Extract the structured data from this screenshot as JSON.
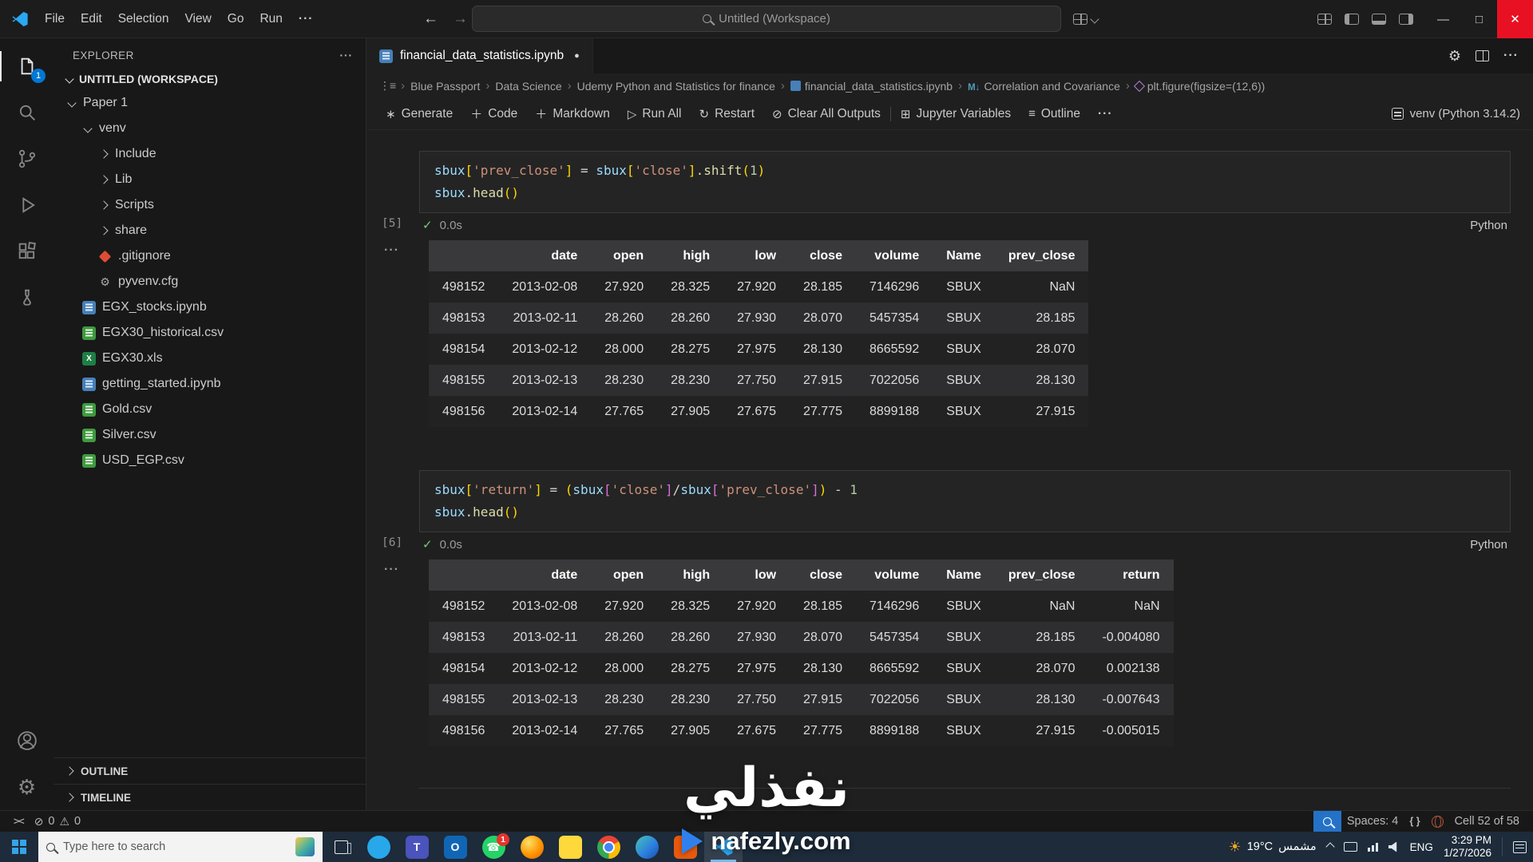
{
  "colors": {
    "accent": "#0078d4",
    "close_button": "#e81123",
    "string": "#CE9178",
    "variable": "#9CDCFE",
    "function": "#DCDCAA",
    "number": "#B5CEA8",
    "bracket1": "#FFD700",
    "bracket2": "#DA70D6"
  },
  "title_bar": {
    "menus": [
      "File",
      "Edit",
      "Selection",
      "View",
      "Go",
      "Run"
    ],
    "search_label": "Untitled (Workspace)"
  },
  "activity_badge": "1",
  "sidebar": {
    "header": "EXPLORER",
    "workspace_label": "UNTITLED (WORKSPACE)",
    "tree": [
      {
        "label": "Paper 1",
        "kind": "folder",
        "open": true,
        "indent": 0
      },
      {
        "label": "venv",
        "kind": "folder",
        "open": true,
        "indent": 1
      },
      {
        "label": "Include",
        "kind": "folder",
        "open": false,
        "indent": 2
      },
      {
        "label": "Lib",
        "kind": "folder",
        "open": false,
        "indent": 2
      },
      {
        "label": "Scripts",
        "kind": "folder",
        "open": false,
        "indent": 2
      },
      {
        "label": "share",
        "kind": "folder",
        "open": false,
        "indent": 2
      },
      {
        "label": ".gitignore",
        "kind": "file",
        "icon": "git",
        "indent": 2
      },
      {
        "label": "pyvenv.cfg",
        "kind": "file",
        "icon": "gear",
        "indent": 2
      },
      {
        "label": "EGX_stocks.ipynb",
        "kind": "file",
        "icon": "notebook",
        "indent": 1
      },
      {
        "label": "EGX30_historical.csv",
        "kind": "file",
        "icon": "csv",
        "indent": 1
      },
      {
        "label": "EGX30.xls",
        "kind": "file",
        "icon": "xls",
        "indent": 1
      },
      {
        "label": "getting_started.ipynb",
        "kind": "file",
        "icon": "notebook",
        "indent": 1
      },
      {
        "label": "Gold.csv",
        "kind": "file",
        "icon": "csv",
        "indent": 1
      },
      {
        "label": "Silver.csv",
        "kind": "file",
        "icon": "csv",
        "indent": 1
      },
      {
        "label": "USD_EGP.csv",
        "kind": "file",
        "icon": "csv",
        "indent": 1
      }
    ],
    "sections": [
      "OUTLINE",
      "TIMELINE"
    ]
  },
  "editor": {
    "tab": {
      "label": "financial_data_statistics.ipynb"
    },
    "breadcrumbs": [
      {
        "label": "Blue Passport"
      },
      {
        "label": "Data Science"
      },
      {
        "label": "Udemy Python and Statistics for finance"
      },
      {
        "label": "financial_data_statistics.ipynb",
        "icon": "notebook"
      },
      {
        "label": "Correlation and Covariance",
        "icon": "markdown"
      },
      {
        "label": "plt.figure(figsize=(12,6))",
        "icon": "symbol"
      }
    ],
    "toolbar": {
      "generate": "Generate",
      "code": "Code",
      "markdown": "Markdown",
      "run_all": "Run All",
      "restart": "Restart",
      "clear": "Clear All Outputs",
      "variables": "Jupyter Variables",
      "outline": "Outline",
      "kernel": "venv (Python 3.14.2)"
    },
    "cells": [
      {
        "exec": "[5]",
        "duration": "0.0s",
        "lang": "Python",
        "code": [
          [
            [
              "v",
              "sbux"
            ],
            [
              "b1",
              "["
            ],
            [
              "s",
              "'prev_close'"
            ],
            [
              "b1",
              "]"
            ],
            [
              "o",
              " = "
            ],
            [
              "v",
              "sbux"
            ],
            [
              "b1",
              "["
            ],
            [
              "s",
              "'close'"
            ],
            [
              "b1",
              "]"
            ],
            [
              "p",
              "."
            ],
            [
              "f",
              "shift"
            ],
            [
              "b1",
              "("
            ],
            [
              "n",
              "1"
            ],
            [
              "b1",
              ")"
            ]
          ],
          [
            [
              "v",
              "sbux"
            ],
            [
              "p",
              "."
            ],
            [
              "f",
              "head"
            ],
            [
              "b1",
              "()"
            ]
          ]
        ],
        "table": {
          "columns": [
            "",
            "date",
            "open",
            "high",
            "low",
            "close",
            "volume",
            "Name",
            "prev_close"
          ],
          "rows": [
            [
              "498152",
              "2013-02-08",
              "27.920",
              "28.325",
              "27.920",
              "28.185",
              "7146296",
              "SBUX",
              "NaN"
            ],
            [
              "498153",
              "2013-02-11",
              "28.260",
              "28.260",
              "27.930",
              "28.070",
              "5457354",
              "SBUX",
              "28.185"
            ],
            [
              "498154",
              "2013-02-12",
              "28.000",
              "28.275",
              "27.975",
              "28.130",
              "8665592",
              "SBUX",
              "28.070"
            ],
            [
              "498155",
              "2013-02-13",
              "28.230",
              "28.230",
              "27.750",
              "27.915",
              "7022056",
              "SBUX",
              "28.130"
            ],
            [
              "498156",
              "2013-02-14",
              "27.765",
              "27.905",
              "27.675",
              "27.775",
              "8899188",
              "SBUX",
              "27.915"
            ]
          ]
        }
      },
      {
        "exec": "[6]",
        "duration": "0.0s",
        "lang": "Python",
        "code": [
          [
            [
              "v",
              "sbux"
            ],
            [
              "b1",
              "["
            ],
            [
              "s",
              "'return'"
            ],
            [
              "b1",
              "]"
            ],
            [
              "o",
              " = "
            ],
            [
              "b1",
              "("
            ],
            [
              "v",
              "sbux"
            ],
            [
              "b2",
              "["
            ],
            [
              "s",
              "'close'"
            ],
            [
              "b2",
              "]"
            ],
            [
              "o",
              "/"
            ],
            [
              "v",
              "sbux"
            ],
            [
              "b2",
              "["
            ],
            [
              "s",
              "'prev_close'"
            ],
            [
              "b2",
              "]"
            ],
            [
              "b1",
              ")"
            ],
            [
              "o",
              " - "
            ],
            [
              "n",
              "1"
            ]
          ],
          [
            [
              "v",
              "sbux"
            ],
            [
              "p",
              "."
            ],
            [
              "f",
              "head"
            ],
            [
              "b1",
              "()"
            ]
          ]
        ],
        "table": {
          "columns": [
            "",
            "date",
            "open",
            "high",
            "low",
            "close",
            "volume",
            "Name",
            "prev_close",
            "return"
          ],
          "rows": [
            [
              "498152",
              "2013-02-08",
              "27.920",
              "28.325",
              "27.920",
              "28.185",
              "7146296",
              "SBUX",
              "NaN",
              "NaN"
            ],
            [
              "498153",
              "2013-02-11",
              "28.260",
              "28.260",
              "27.930",
              "28.070",
              "5457354",
              "SBUX",
              "28.185",
              "-0.004080"
            ],
            [
              "498154",
              "2013-02-12",
              "28.000",
              "28.275",
              "27.975",
              "28.130",
              "8665592",
              "SBUX",
              "28.070",
              "0.002138"
            ],
            [
              "498155",
              "2013-02-13",
              "28.230",
              "28.230",
              "27.750",
              "27.915",
              "7022056",
              "SBUX",
              "28.130",
              "-0.007643"
            ],
            [
              "498156",
              "2013-02-14",
              "27.765",
              "27.905",
              "27.675",
              "27.775",
              "8899188",
              "SBUX",
              "27.915",
              "-0.005015"
            ]
          ]
        }
      }
    ]
  },
  "status_bar": {
    "errors": "0",
    "warnings": "0",
    "spaces": "Spaces: 4",
    "cell_pos": "Cell 52 of 58"
  },
  "taskbar": {
    "search_placeholder": "Type here to search",
    "apps": [
      {
        "name": "skype",
        "shape": "circle",
        "bg": "#28a8ea"
      },
      {
        "name": "teams",
        "shape": "rounded",
        "bg": "#4b53bc",
        "glyph": "T"
      },
      {
        "name": "outlook",
        "shape": "rounded",
        "bg": "#1066b5",
        "glyph": "O"
      },
      {
        "name": "whatsapp",
        "shape": "circle",
        "bg": "#25d366",
        "glyph": "☎",
        "badge": "1"
      },
      {
        "name": "firefox",
        "shape": "circle"
      },
      {
        "name": "sticky-notes",
        "shape": "rounded",
        "bg": "#ffd83b"
      },
      {
        "name": "chrome",
        "shape": "circle"
      },
      {
        "name": "edge",
        "shape": "circle"
      },
      {
        "name": "office",
        "shape": "rounded",
        "bg": "#e8590c"
      },
      {
        "name": "vscode",
        "shape": "none",
        "active": true
      }
    ],
    "tray": {
      "temp": "19°C",
      "weather": "مشمس",
      "lang": "ENG",
      "time": "3:29 PM",
      "date": "1/27/2026"
    }
  },
  "watermark": {
    "big": "نفذلي",
    "site": "nafezly.com"
  }
}
